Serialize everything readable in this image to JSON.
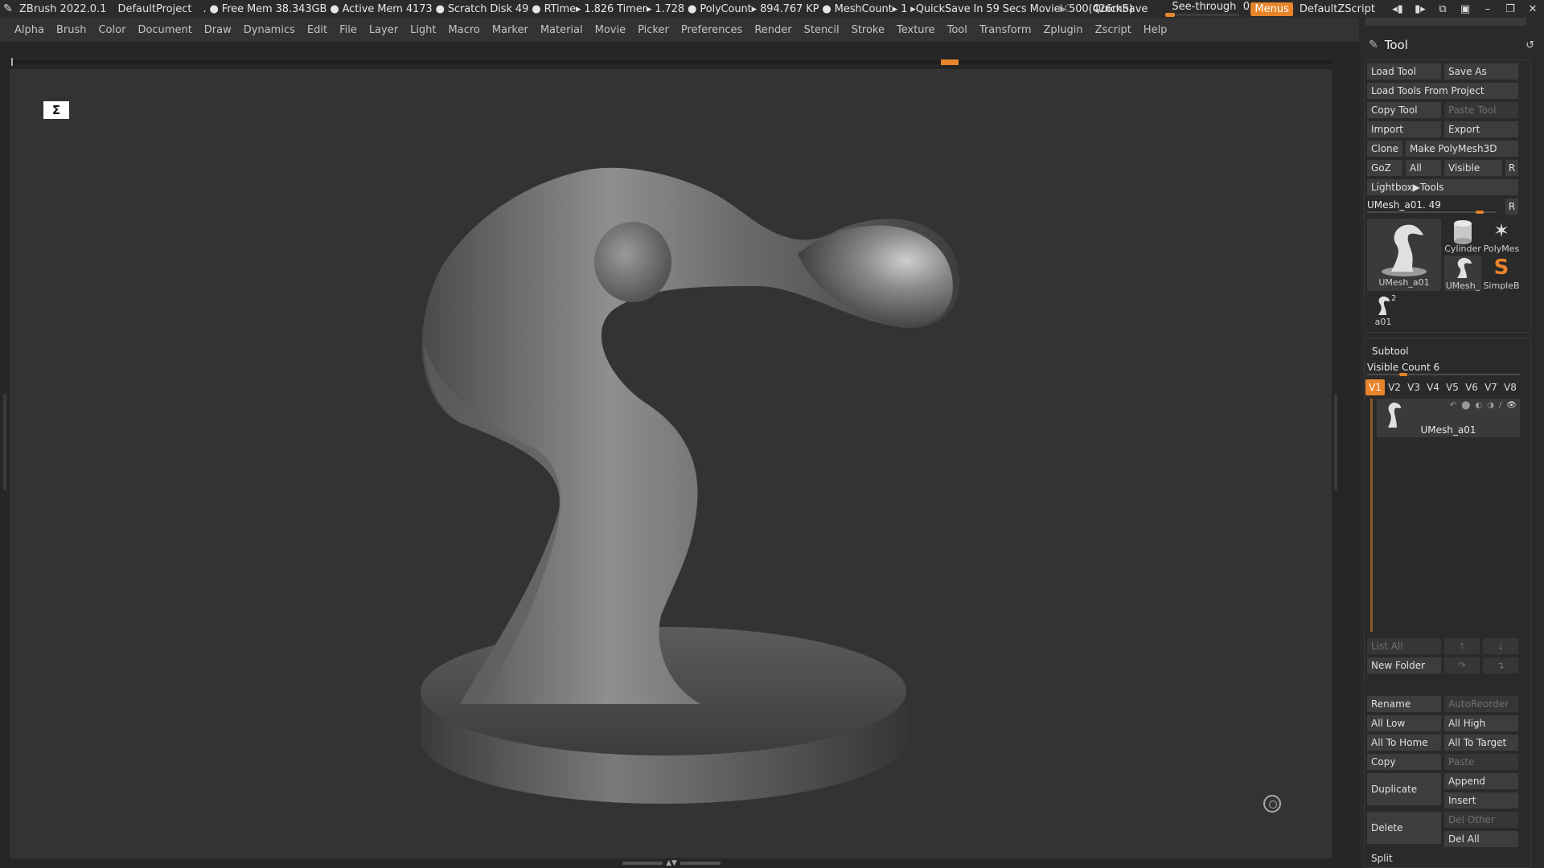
{
  "titlebar": {
    "app": "ZBrush 2022.0.1",
    "project": "DefaultProject",
    "stats": ". ● Free Mem 38.343GB ● Active Mem 4173 ● Scratch Disk 49 ●  RTime▸ 1.826 Timer▸ 1.728 ● PolyCount▸ 894.767 KP  ● MeshCount▸ 1  ▸QuickSave In 59 Secs Movie▸ 500(426mb)",
    "ac": "AC",
    "quicksave": "QuickSave",
    "see_through_label": "See-through",
    "see_through_value": "0",
    "see_through_fraction": 0,
    "menus": "Menus",
    "script": "DefaultZScript"
  },
  "menubar": [
    "Alpha",
    "Brush",
    "Color",
    "Document",
    "Draw",
    "Dynamics",
    "Edit",
    "File",
    "Layer",
    "Light",
    "Macro",
    "Marker",
    "Material",
    "Movie",
    "Picker",
    "Preferences",
    "Render",
    "Stencil",
    "Stroke",
    "Texture",
    "Tool",
    "Transform",
    "Zplugin",
    "Zscript",
    "Help"
  ],
  "panel": {
    "title": "Tool",
    "load_tool": "Load Tool",
    "save_as": "Save As",
    "load_from_project": "Load Tools From Project",
    "copy_tool": "Copy Tool",
    "paste_tool": "Paste Tool",
    "import": "Import",
    "export": "Export",
    "clone": "Clone",
    "make_polymesh": "Make PolyMesh3D",
    "goz": "GoZ",
    "all": "All",
    "visible": "Visible",
    "r": "R",
    "lightbox_tools": "Lightbox▶Tools",
    "umesh_slider_label": "UMesh_a01. 49",
    "umesh_slider_fraction": 0.9,
    "thumbs": {
      "main": "UMesh_a01",
      "cylinder": "Cylinder",
      "polymesh": "PolyMes",
      "umesh_small": "UMesh_",
      "simpleb": "SimpleB",
      "a01": "a01",
      "a01_badge": "2"
    },
    "subtool": {
      "title": "Subtool",
      "visible_count": "Visible Count 6",
      "visible_count_fraction": 0.22,
      "tabs": [
        "V1",
        "V2",
        "V3",
        "V4",
        "V5",
        "V6",
        "V7",
        "V8"
      ],
      "active_tab": "V1",
      "item_name": "UMesh_a01",
      "list_all": "List All",
      "new_folder": "New Folder"
    },
    "rename": "Rename",
    "auto_reorder": "AutoReorder",
    "all_low": "All Low",
    "all_high": "All High",
    "all_to_home": "All To Home",
    "all_to_target": "All To Target",
    "copy": "Copy",
    "paste": "Paste",
    "duplicate": "Duplicate",
    "append": "Append",
    "insert": "Insert",
    "delete": "Delete",
    "del_other": "Del Other",
    "del_all": "Del All",
    "split": "Split"
  },
  "colors": {
    "accent": "#e8842a",
    "viewport_bg": "#333333",
    "panel_bg": "#2a2a2a",
    "button_bg": "#3d3d3d"
  }
}
